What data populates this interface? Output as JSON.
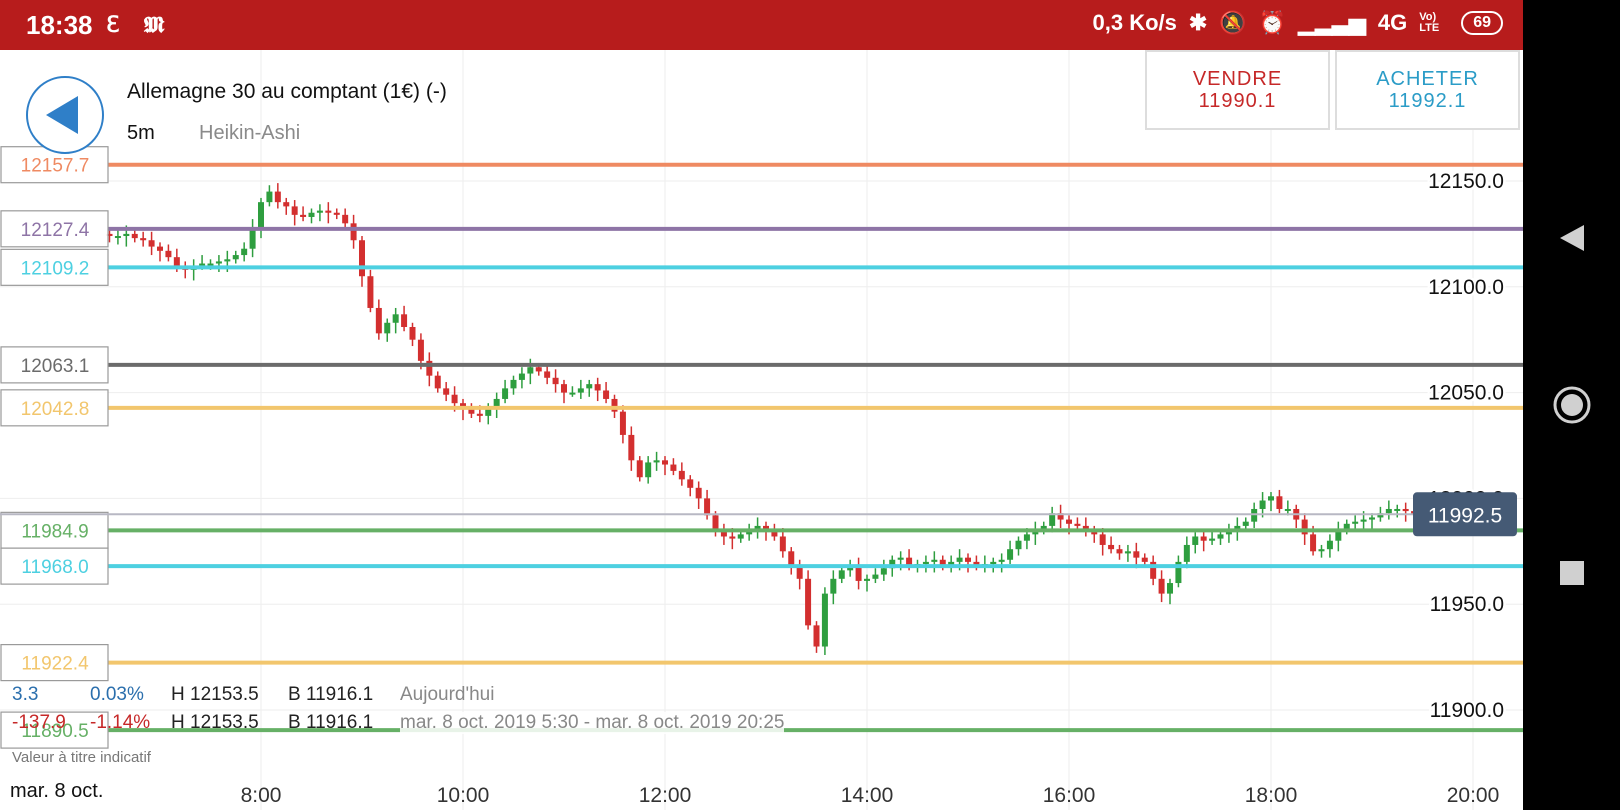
{
  "status_bar": {
    "time": "18:38",
    "net_speed": "0,3 Ko/s",
    "network": "4G",
    "volte": "Vo) LTE",
    "battery": "69"
  },
  "header": {
    "instrument": "Allemagne 30 au comptant (1€) (-)",
    "timeframe": "5m",
    "chart_type": "Heikin-Ashi"
  },
  "trade": {
    "sell_label": "VENDRE",
    "sell_price": "11990.1",
    "buy_label": "ACHETER",
    "buy_price": "11992.1"
  },
  "stats": {
    "today": {
      "change": "3.3",
      "pct": "0.03%",
      "high": "H 12153.5",
      "low": "B 11916.1",
      "period": "Aujourd'hui"
    },
    "range": {
      "change": "-137.9",
      "pct": "-1.14%",
      "high": "H 12153.5",
      "low": "B 11916.1",
      "period": "mar. 8 oct. 2019 5:30 - mar. 8 oct. 2019 20:25"
    }
  },
  "disclaimer": "Valeur à titre indicatif",
  "date_label": "mar. 8 oct.",
  "colors": {
    "status_bar": "#b71c1c",
    "up": "#2e9e3f",
    "down": "#d32f2f",
    "sell": "#c62828",
    "buy": "#2b9cc7",
    "current_price_tag": "#455a75"
  },
  "chart_data": {
    "type": "candlestick",
    "y_ticks": [
      "12150.0",
      "12100.0",
      "12050.0",
      "12000.0",
      "11950.0",
      "11900.0"
    ],
    "x_ticks": [
      "8:00",
      "10:00",
      "12:00",
      "14:00",
      "16:00",
      "18:00",
      "20:00"
    ],
    "ylim": [
      11880,
      12170
    ],
    "xlim_hours": [
      6.0,
      20.3
    ],
    "current_price": "11992.5",
    "levels": [
      {
        "label": "12157.7",
        "value": 12157.7,
        "color": "#ef8a62"
      },
      {
        "label": "12127.4",
        "value": 12127.4,
        "color": "#8e74a6"
      },
      {
        "label": "12109.2",
        "value": 12109.2,
        "color": "#4dd0e1"
      },
      {
        "label": "12063.1",
        "value": 12063.1,
        "color": "#6b6b6b"
      },
      {
        "label": "12042.8",
        "value": 12042.8,
        "color": "#f2c66d"
      },
      {
        "label": "11984.9",
        "value": 11984.9,
        "color": "#66b066"
      },
      {
        "label": "11968.0",
        "value": 11968.0,
        "color": "#4dd0e1"
      },
      {
        "label": "11922.4",
        "value": 11922.4,
        "color": "#f2c66d"
      },
      {
        "label": "11890.5",
        "value": 11890.5,
        "color": "#66b066"
      }
    ],
    "candle_interval_minutes": 5,
    "start_time": "6:30",
    "closes": [
      12124,
      12124,
      12125,
      12123,
      12122,
      12119,
      12117,
      12114,
      12110,
      12108,
      12110,
      12111,
      12111,
      12112,
      12113,
      12115,
      12118,
      12128,
      12140,
      12145,
      12140,
      12138,
      12134,
      12133,
      12135,
      12136,
      12135,
      12134,
      12130,
      12122,
      12105,
      12090,
      12078,
      12083,
      12087,
      12081,
      12075,
      12065,
      12058,
      12052,
      12049,
      12045,
      12042,
      12040,
      12039,
      12043,
      12047,
      12052,
      12056,
      12059,
      12062,
      12060,
      12057,
      12054,
      12050,
      12050,
      12052,
      12054,
      12051,
      12047,
      12041,
      12030,
      12018,
      12010,
      12017,
      12018,
      12016,
      12013,
      12009,
      12005,
      12000,
      11992,
      11985,
      11982,
      11981,
      11983,
      11985,
      11987,
      11985,
      11982,
      11975,
      11968,
      11962,
      11940,
      11930,
      11955,
      11962,
      11966,
      11968,
      11961,
      11962,
      11964,
      11967,
      11971,
      11972,
      11968,
      11969,
      11970,
      11971,
      11968,
      11970,
      11972,
      11970,
      11968,
      11969,
      11970,
      11971,
      11976,
      11980,
      11983,
      11985,
      11987,
      11993,
      11990,
      11988,
      11987,
      11985,
      11983,
      11978,
      11976,
      11974,
      11975,
      11972,
      11970,
      11962,
      11955,
      11960,
      11970,
      11978,
      11982,
      11980,
      11981,
      11983,
      11985,
      11987,
      11989,
      11995,
      11999,
      12001,
      11995,
      11995,
      11990,
      11983,
      11975,
      11976,
      11980,
      11985,
      11988,
      11989,
      11990,
      11991,
      11993,
      11995,
      11995,
      11994,
      11992.5
    ]
  }
}
